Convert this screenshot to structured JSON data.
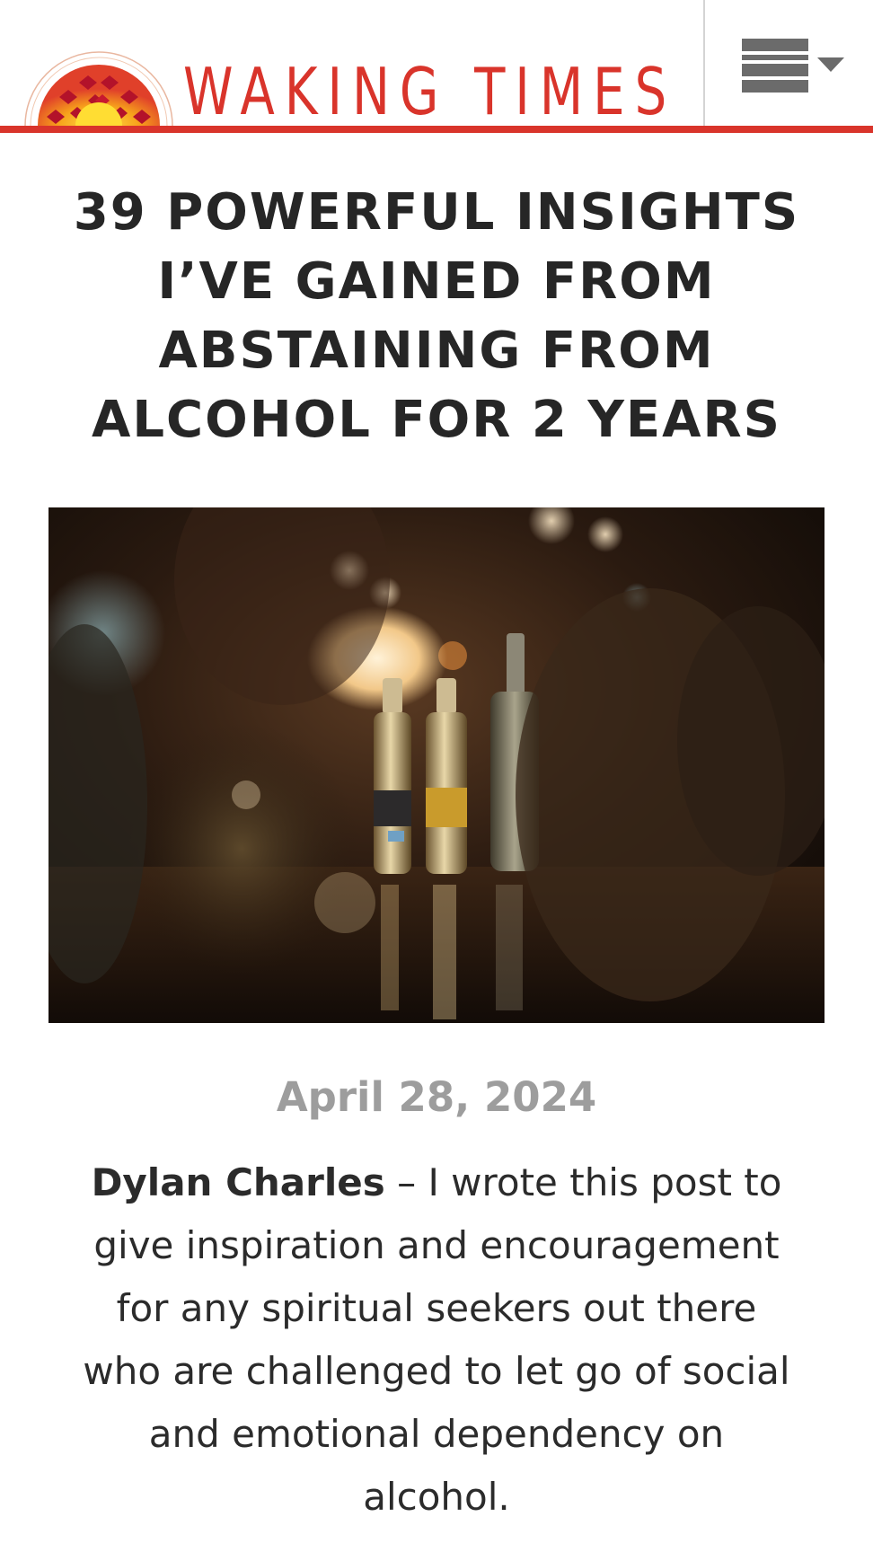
{
  "site": {
    "name": "WAKING TIMES",
    "brand_color": "#d9342b",
    "menu_icon": "hamburger-dropdown-icon"
  },
  "article": {
    "title": "39 Powerful Insights I’ve Gained from Abstaining from Alcohol for 2 Years",
    "hero_image": {
      "icon": "bar-bottles-photo"
    },
    "date": "April 28, 2024",
    "author": "Dylan Charles",
    "separator": " – ",
    "intro": "I wrote this post to give inspiration and encouragement for any spiritual seekers out there who are challenged to let go of social and emotional dependency on alcohol."
  },
  "colors": {
    "headline": "#262626",
    "date": "#9d9d9d",
    "menu": "#6b6b6b",
    "divider": "#d4d4d4"
  }
}
